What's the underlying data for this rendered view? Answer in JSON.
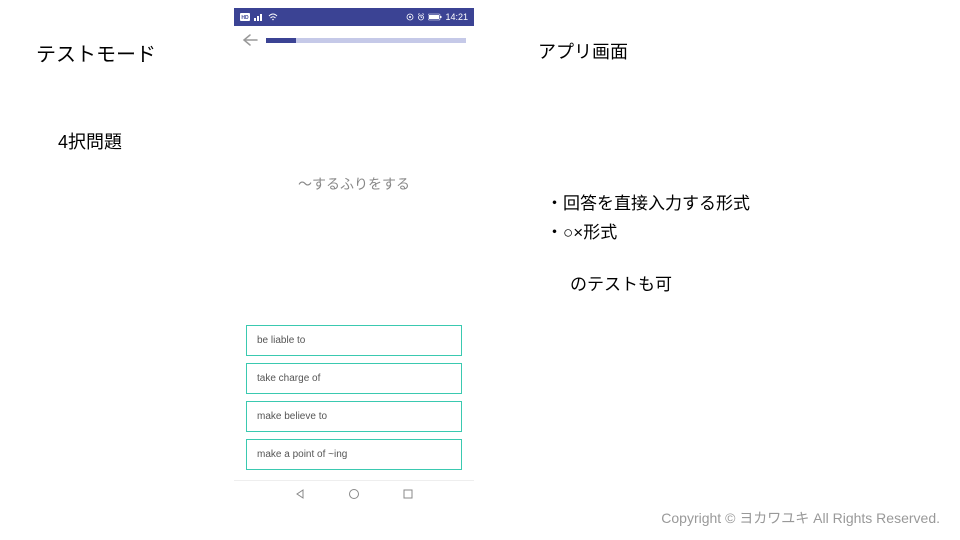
{
  "labels": {
    "test_mode": "テストモード",
    "four_choice": "4択問題",
    "app_screen": "アプリ画面"
  },
  "bullets": {
    "line1": "・回答を直接入力する形式",
    "line2": "・○×形式",
    "followup": "のテストも可"
  },
  "copyright": "Copyright © ヨカワユキ All Rights Reserved.",
  "phone": {
    "status": {
      "time": "14:21"
    },
    "question": "〜するふりをする",
    "choices": [
      "be liable to",
      "take charge of",
      "make believe to",
      "make a point of ~ing"
    ]
  }
}
